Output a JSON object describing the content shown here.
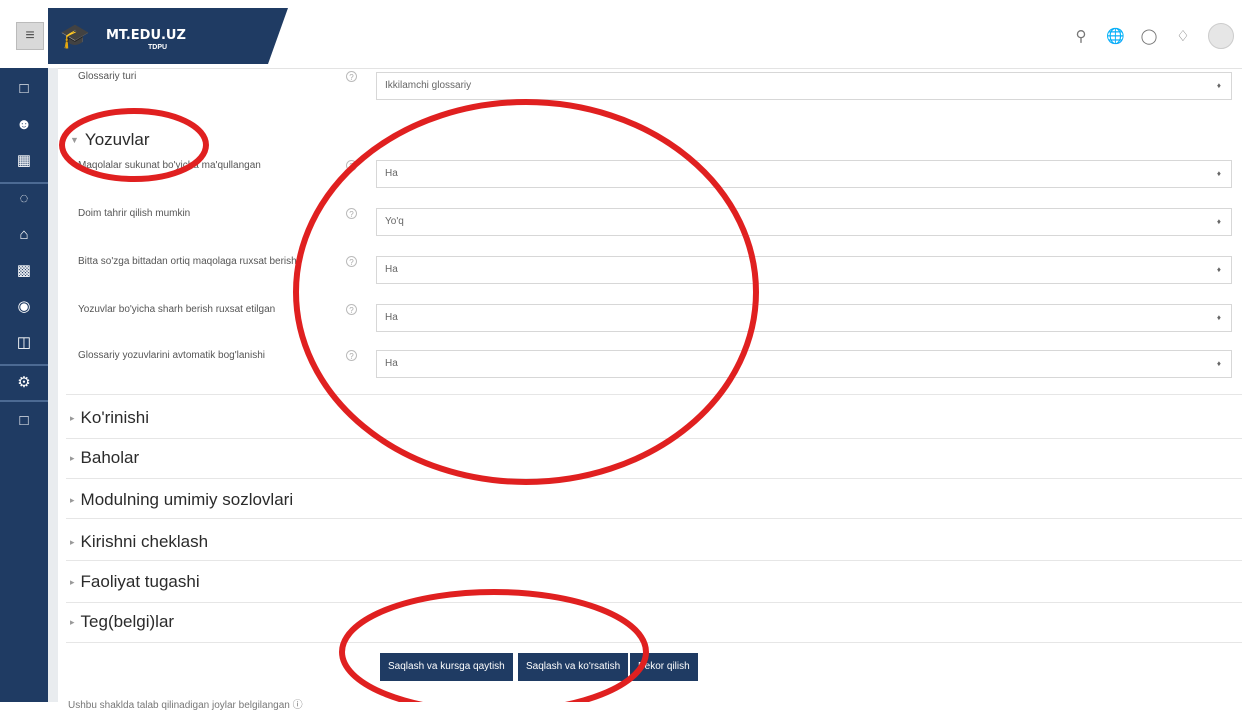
{
  "header": {
    "menu_icon": "hamburger-icon",
    "brand_title": "MT.EDU.UZ",
    "brand_sub": "TDPU",
    "icons": [
      "search-icon",
      "globe-icon",
      "chat-icon",
      "bell-icon",
      "avatar"
    ]
  },
  "sidebar": {
    "icons": [
      "folder-icon",
      "users-icon",
      "grades-icon",
      "dashboard-icon",
      "home-icon",
      "calendar-icon",
      "graduation-icon",
      "files-icon",
      "gear-icon",
      "folder-icon"
    ]
  },
  "form": {
    "top_row": {
      "label": "Glossariy turi",
      "value": "Ikkilamchi glossariy"
    },
    "entries_section": "Yozuvlar",
    "rows": [
      {
        "label": "Maqolalar sukunat bo'yicha ma'qullangan",
        "value": "Ha"
      },
      {
        "label": "Doim tahrir qilish mumkin",
        "value": "Yo'q"
      },
      {
        "label": "Bitta so'zga bittadan ortiq maqolaga ruxsat berish",
        "value": "Ha"
      },
      {
        "label": "Yozuvlar bo'yicha sharh berish ruxsat etilgan",
        "value": "Ha"
      },
      {
        "label": "Glossariy yozuvlarini avtomatik bog'lanishi",
        "value": "Ha"
      }
    ],
    "collapsed_sections": [
      "Ko'rinishi",
      "Baholar",
      "Modulning umimiy sozlovlari",
      "Kirishni cheklash",
      "Faoliyat tugashi",
      "Teg(belgi)lar"
    ]
  },
  "buttons": {
    "save_return": "Saqlash va kursga qaytish",
    "save_display": "Saqlash va ko'rsatish",
    "cancel": "Bekor qilish"
  },
  "footer": {
    "note": "Ushbu shaklda talab qilinadigan joylar belgilangan"
  },
  "colors": {
    "primary": "#1f3b63",
    "annotation": "#e02020"
  }
}
